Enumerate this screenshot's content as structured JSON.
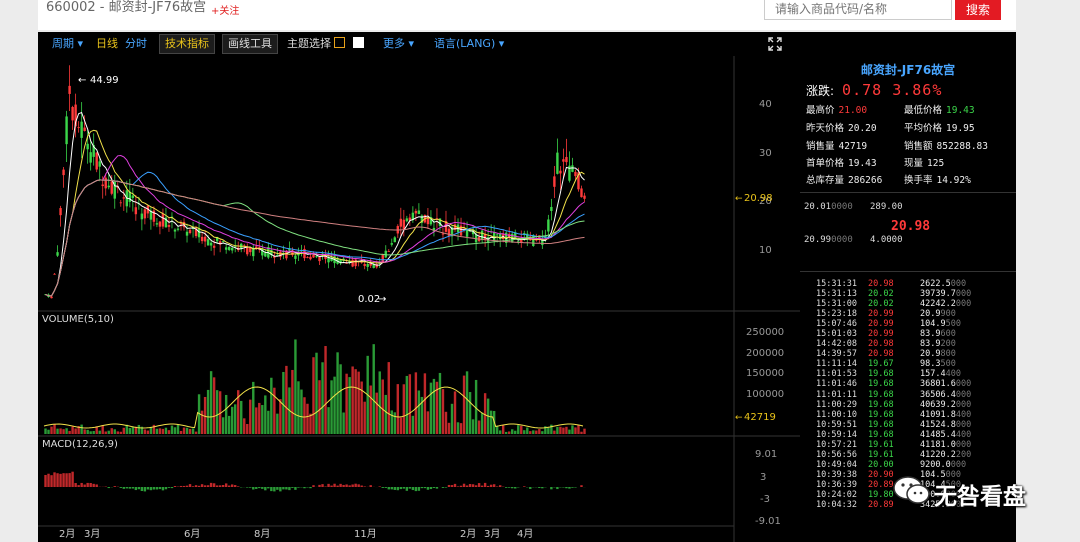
{
  "header": {
    "code_title": "660002 - 邮资封-JF76故宫",
    "follow_label": "+关注",
    "search_placeholder": "请输入商品代码/名称",
    "search_button": "搜索"
  },
  "toolbar": {
    "period": "周期",
    "daily": "日线",
    "minute": "分时",
    "tech": "技术指标",
    "draw": "画线工具",
    "theme": "主题选择",
    "more": "更多",
    "lang": "语言(LANG)"
  },
  "chart_labels": {
    "high_marker": "44.99",
    "low_marker": "0.02",
    "price_marker": "20.98",
    "vol_marker": "42719",
    "volume_title": "VOLUME(5,10)",
    "macd_title": "MACD(12,26,9)"
  },
  "price_axis": [
    "40",
    "30",
    "20",
    "10"
  ],
  "volume_axis": [
    "250000",
    "200000",
    "150000",
    "100000"
  ],
  "macd_axis": [
    "9.01",
    "3",
    "-3",
    "-9.01"
  ],
  "x_labels": [
    "2月",
    "3月",
    "6月",
    "8月",
    "11月",
    "2月",
    "3月",
    "4月"
  ],
  "quote": {
    "title": "邮资封-JF76故宫",
    "change_label": "涨跌:",
    "change_value": "0.78 3.86%",
    "stats": [
      [
        "最高价",
        "21.00",
        "最低价格",
        "19.43"
      ],
      [
        "昨天价格",
        "20.20",
        "平均价格",
        "19.95"
      ],
      [
        "销售量",
        "42719",
        "销售额",
        "852288.83"
      ],
      [
        "首单价格",
        "19.43",
        "现量",
        "125"
      ],
      [
        "总库存量",
        "286266",
        "换手率",
        "14.92%"
      ]
    ],
    "sell": {
      "price": "20.01",
      "price_suffix": "0000",
      "qty": "289.00"
    },
    "last_price": "20.98",
    "buy": {
      "price": "20.99",
      "price_suffix": "0000",
      "qty": "4.0000"
    }
  },
  "trades": [
    [
      "15:31:31",
      "20.98",
      "2622.5000"
    ],
    [
      "15:31:13",
      "20.02",
      "39739.7000"
    ],
    [
      "15:31:00",
      "20.02",
      "42242.2000"
    ],
    [
      "15:23:18",
      "20.99",
      "20.9900"
    ],
    [
      "15:07:46",
      "20.99",
      "104.9500"
    ],
    [
      "15:01:03",
      "20.99",
      "83.9600"
    ],
    [
      "14:42:08",
      "20.98",
      "83.9200"
    ],
    [
      "14:39:57",
      "20.98",
      "20.9800"
    ],
    [
      "11:11:14",
      "19.67",
      "98.3500"
    ],
    [
      "11:01:53",
      "19.68",
      "157.4400"
    ],
    [
      "11:01:46",
      "19.68",
      "36801.6000"
    ],
    [
      "11:01:11",
      "19.68",
      "36506.4000"
    ],
    [
      "11:00:29",
      "19.68",
      "40639.2000"
    ],
    [
      "11:00:10",
      "19.68",
      "41091.8400"
    ],
    [
      "10:59:51",
      "19.68",
      "41524.8000"
    ],
    [
      "10:59:14",
      "19.68",
      "41485.4400"
    ],
    [
      "10:57:21",
      "19.61",
      "41181.0000"
    ],
    [
      "10:56:56",
      "19.61",
      "41220.2200"
    ],
    [
      "10:49:04",
      "20.00",
      "9200.0000"
    ],
    [
      "10:39:38",
      "20.90",
      "104.5000"
    ],
    [
      "10:36:39",
      "20.89",
      "104.4500"
    ],
    [
      "10:24:02",
      "19.80",
      "990.0000"
    ],
    [
      "10:04:32",
      "20.89",
      "3425.9600"
    ]
  ],
  "trade_colors": [
    "red",
    "green",
    "green",
    "red",
    "red",
    "red",
    "red",
    "red",
    "green",
    "green",
    "green",
    "green",
    "green",
    "green",
    "green",
    "green",
    "green",
    "green",
    "green",
    "red",
    "red",
    "green",
    "red"
  ],
  "watermark": "无咎看盘",
  "colors": {
    "up": "#ff3a3a",
    "down": "#3bd64a",
    "accent": "#49a6ff",
    "highlight": "#e8c21a",
    "brand_red": "#e31b23"
  }
}
